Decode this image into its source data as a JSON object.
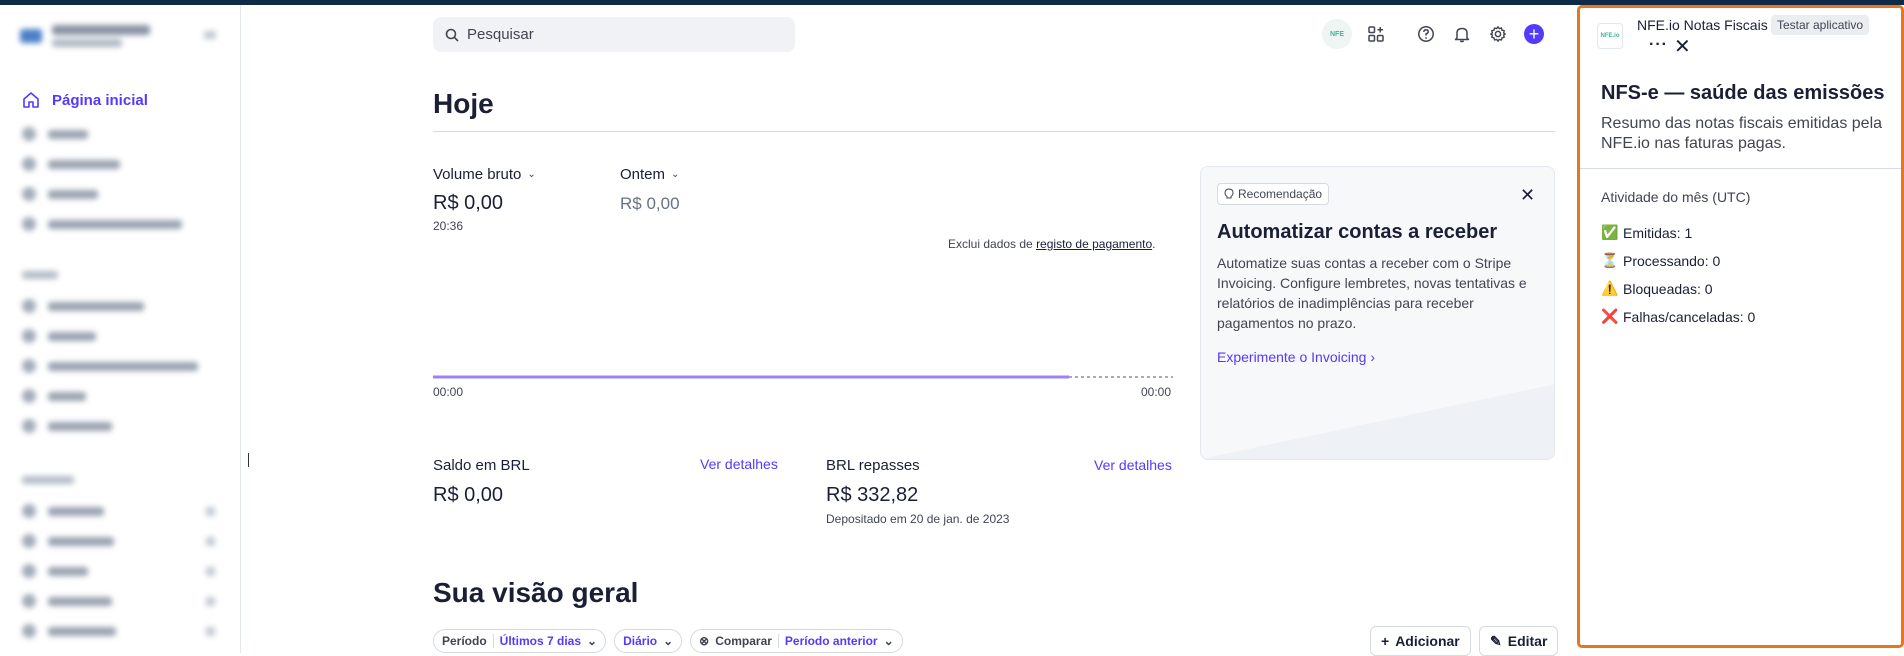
{
  "search": {
    "placeholder": "Pesquisar"
  },
  "sidebar": {
    "home_label": "Página inicial"
  },
  "topbar": {
    "app_chip": "NFE"
  },
  "main": {
    "title": "Hoje",
    "gross_volume": {
      "label": "Volume bruto",
      "value": "R$ 0,00",
      "time": "20:36"
    },
    "yesterday": {
      "label": "Ontem",
      "value": "R$ 0,00"
    },
    "exclude_note": "Exclui dados de ",
    "exclude_link": "registo de pagamento",
    "exclude_end": ".",
    "axis_start": "00:00",
    "axis_end": "00:00",
    "balance": {
      "label": "Saldo em BRL",
      "link": "Ver detalhes",
      "value": "R$ 0,00"
    },
    "payouts": {
      "label": "BRL repasses",
      "link": "Ver detalhes",
      "value": "R$ 332,82",
      "sub": "Depositado em 20 de jan. de 2023"
    },
    "overview_title": "Sua visão geral",
    "filters": {
      "period_label": "Período",
      "period_value": "Últimos 7 dias",
      "interval_value": "Diário",
      "compare_label": "Comparar",
      "compare_value": "Período anterior"
    },
    "add_label": "Adicionar",
    "edit_label": "Editar"
  },
  "recommendation": {
    "badge": "Recomendação",
    "title": "Automatizar contas a receber",
    "body": "Automatize suas contas a receber com o Stripe Invoicing. Configure lembretes, novas tentativas e relatórios de inadimplências para receber pagamentos no prazo.",
    "link": "Experimente o Invoicing"
  },
  "panel": {
    "logo": "NFE.io",
    "app_name": "NFE.io Notas Fiscais",
    "test_badge": "Testar aplicativo",
    "title": "NFS-e — saúde das emissões",
    "description": "Resumo das notas fiscais emitidas pela NFE.io nas faturas pagas.",
    "section": "Atividade do mês (UTC)",
    "stats": [
      {
        "icon": "✅",
        "label": "Emitidas: 1"
      },
      {
        "icon": "⏳",
        "label": "Processando: 0"
      },
      {
        "icon": "⚠️",
        "label": "Bloqueadas: 0"
      },
      {
        "icon": "❌",
        "label": "Falhas/canceladas: 0"
      }
    ]
  },
  "colors": {
    "accent": "#533afd",
    "panel_border": "#e8761f",
    "topbar": "#0f2a47"
  }
}
